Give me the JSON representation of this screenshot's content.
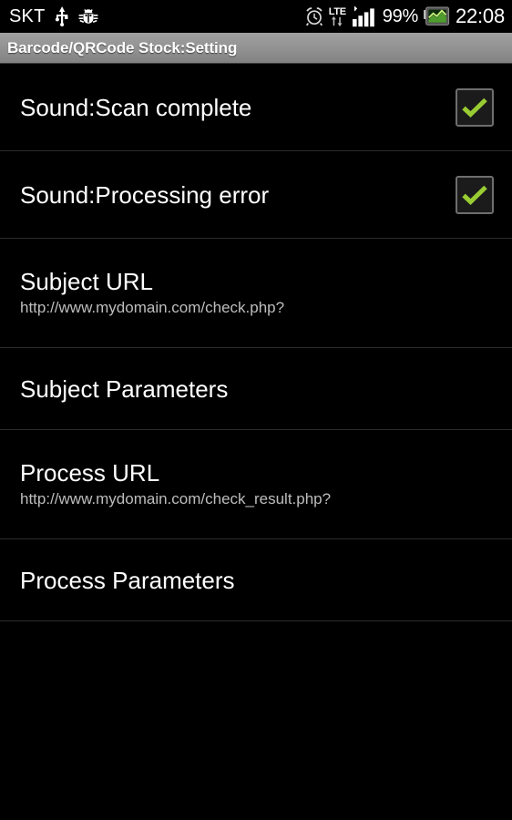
{
  "statusbar": {
    "carrier": "SKT",
    "usb_icon": "usb-icon",
    "debug_icon": "android-debug-bug-icon",
    "alarm_icon": "alarm-clock-icon",
    "network_type": "LTE",
    "data_arrows_icon": "data-transfer-arrows-icon",
    "signal_icon": "signal-bars-icon",
    "battery_percent": "99%",
    "battery_icon": "battery-charging-icon",
    "time": "22:08"
  },
  "titlebar": {
    "title": "Barcode/QRCode Stock:Setting"
  },
  "colors": {
    "background": "#000000",
    "title_gradient_top": "#a0a0a0",
    "title_gradient_bottom": "#828282",
    "divider": "#2c2c2c",
    "checkbox_border": "#6e6e6e",
    "checkmark_green": "#99cc33",
    "summary_text": "#bdbdbd",
    "primary_text": "#ffffff"
  },
  "preferences": [
    {
      "id": "sound-scan-complete",
      "title": "Sound:Scan complete",
      "summary": null,
      "type": "checkbox",
      "checked": true
    },
    {
      "id": "sound-processing-error",
      "title": "Sound:Processing error",
      "summary": null,
      "type": "checkbox",
      "checked": true
    },
    {
      "id": "subject-url",
      "title": "Subject URL",
      "summary": "http://www.mydomain.com/check.php?",
      "type": "edittext"
    },
    {
      "id": "subject-parameters",
      "title": "Subject Parameters",
      "summary": null,
      "type": "edittext"
    },
    {
      "id": "process-url",
      "title": "Process URL",
      "summary": "http://www.mydomain.com/check_result.php?",
      "type": "edittext"
    },
    {
      "id": "process-parameters",
      "title": "Process Parameters",
      "summary": null,
      "type": "edittext"
    }
  ]
}
